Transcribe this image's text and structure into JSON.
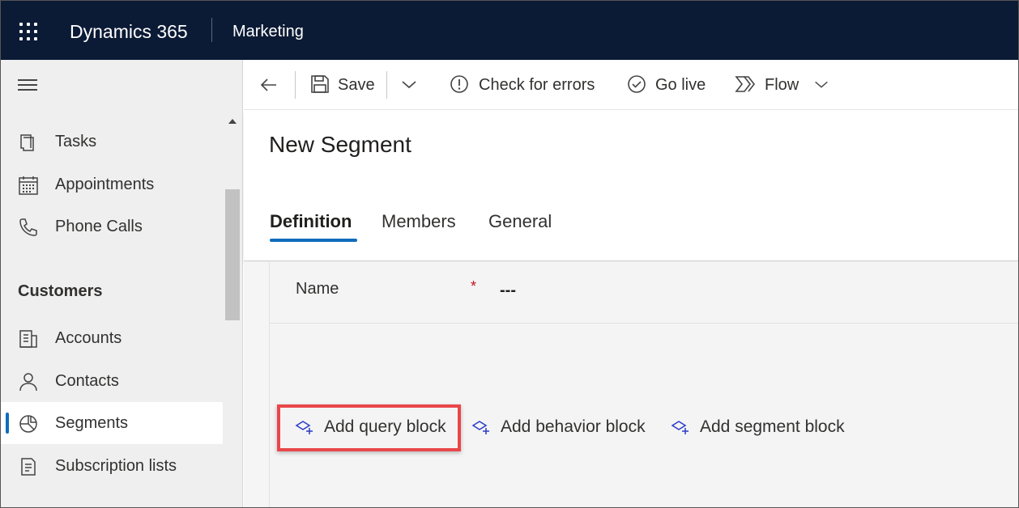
{
  "topbar": {
    "app_name": "Dynamics 365",
    "module_name": "Marketing"
  },
  "sidebar": {
    "items_top": [
      {
        "label": "Tasks",
        "icon": "tasks-icon"
      },
      {
        "label": "Appointments",
        "icon": "calendar-icon"
      },
      {
        "label": "Phone Calls",
        "icon": "phone-icon"
      }
    ],
    "group_heading": "Customers",
    "items_customers": [
      {
        "label": "Accounts",
        "icon": "accounts-icon"
      },
      {
        "label": "Contacts",
        "icon": "person-icon"
      },
      {
        "label": "Segments",
        "icon": "segments-pie-icon",
        "selected": true
      },
      {
        "label": "Subscription lists",
        "icon": "subscription-list-icon"
      }
    ]
  },
  "commandbar": {
    "save": "Save",
    "check_errors": "Check for errors",
    "go_live": "Go live",
    "flow": "Flow"
  },
  "page": {
    "title": "New Segment",
    "tabs": [
      {
        "label": "Definition",
        "active": true
      },
      {
        "label": "Members"
      },
      {
        "label": "General"
      }
    ]
  },
  "form": {
    "name_label": "Name",
    "required_mark": "*",
    "name_value": "---"
  },
  "blocks": {
    "add_query": "Add query block",
    "add_behavior": "Add behavior block",
    "add_segment": "Add segment block"
  },
  "colors": {
    "topbar_bg": "#0b1a35",
    "accent": "#0f6cbd",
    "highlight": "#e8474a",
    "block_icon": "#2b3bc7"
  }
}
